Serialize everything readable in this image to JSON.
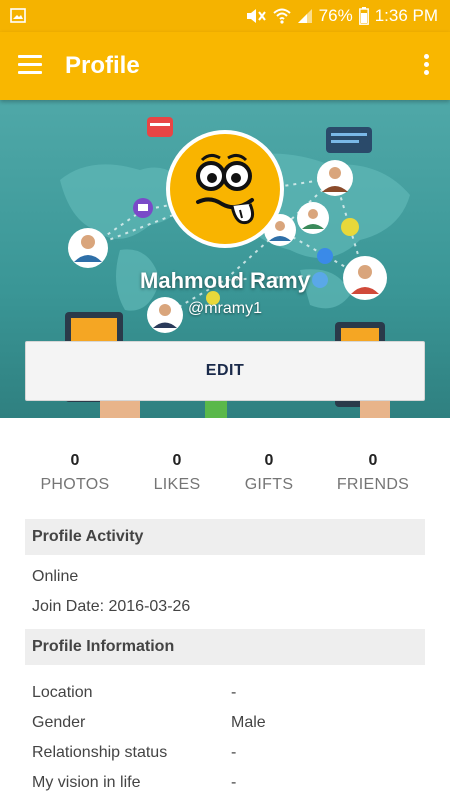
{
  "status_bar": {
    "battery": "76%",
    "time": "1:36 PM"
  },
  "app_bar": {
    "title": "Profile"
  },
  "profile": {
    "name": "Mahmoud Ramy",
    "handle": "@mramy1",
    "edit_label": "EDIT"
  },
  "stats": [
    {
      "count": "0",
      "label": "PHOTOS"
    },
    {
      "count": "0",
      "label": "LIKES"
    },
    {
      "count": "0",
      "label": "GIFTS"
    },
    {
      "count": "0",
      "label": "FRIENDS"
    }
  ],
  "activity": {
    "header": "Profile Activity",
    "status": "Online",
    "join_date": "Join Date: 2016-03-26"
  },
  "information": {
    "header": "Profile Information",
    "rows": [
      {
        "label": "Location",
        "value": "-"
      },
      {
        "label": "Gender",
        "value": "Male"
      },
      {
        "label": "Relationship status",
        "value": "-"
      },
      {
        "label": "My vision in life",
        "value": "-"
      }
    ]
  },
  "colors": {
    "accent": "#f9b700",
    "cover": "#3a9696"
  },
  "icons": {
    "status_left": "image-icon",
    "mute": "mute-icon",
    "wifi": "wifi-icon",
    "signal": "signal-icon",
    "battery": "battery-icon",
    "menu": "hamburger-menu-icon",
    "overflow": "more-vert-icon"
  }
}
